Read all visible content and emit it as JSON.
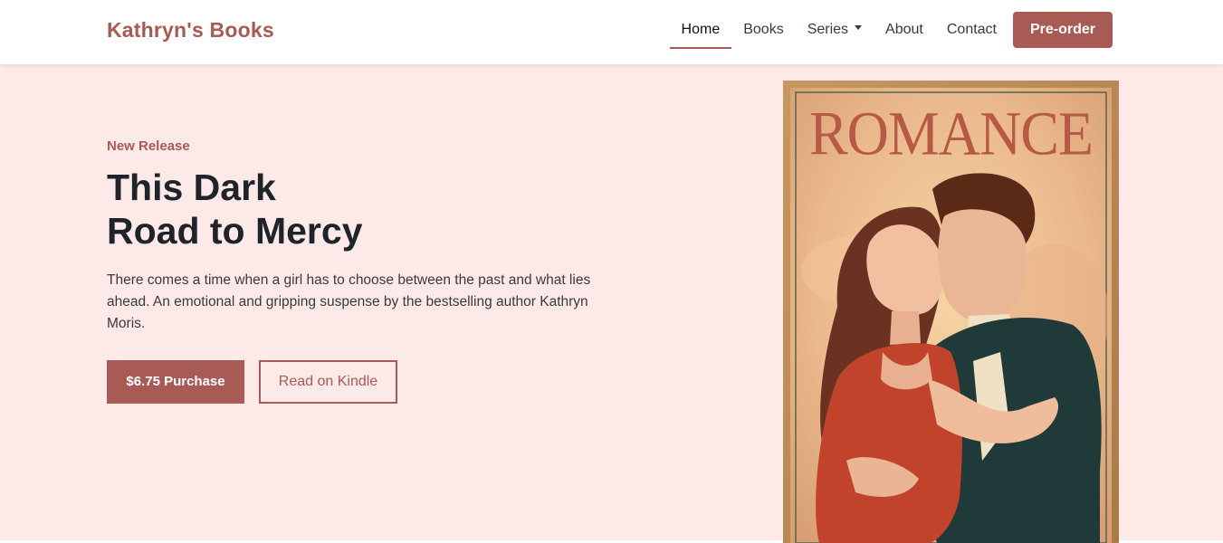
{
  "brand": "Kathryn's Books",
  "nav": {
    "home": "Home",
    "books": "Books",
    "series": "Series",
    "about": "About",
    "contact": "Contact",
    "preorder": "Pre-order"
  },
  "hero": {
    "eyebrow": "New Release",
    "title_line1": "This Dark",
    "title_line2": "Road to Mercy",
    "description": "There comes a time when a girl has to choose between the past and what lies ahead. An emotional and gripping suspense by the bestselling author Kathryn Moris.",
    "purchase_label": "$6.75 Purchase",
    "kindle_label": "Read on Kindle"
  },
  "cover": {
    "title": "ROMANCE"
  },
  "colors": {
    "accent": "#a85a54",
    "hero_bg": "#fdeae8"
  }
}
